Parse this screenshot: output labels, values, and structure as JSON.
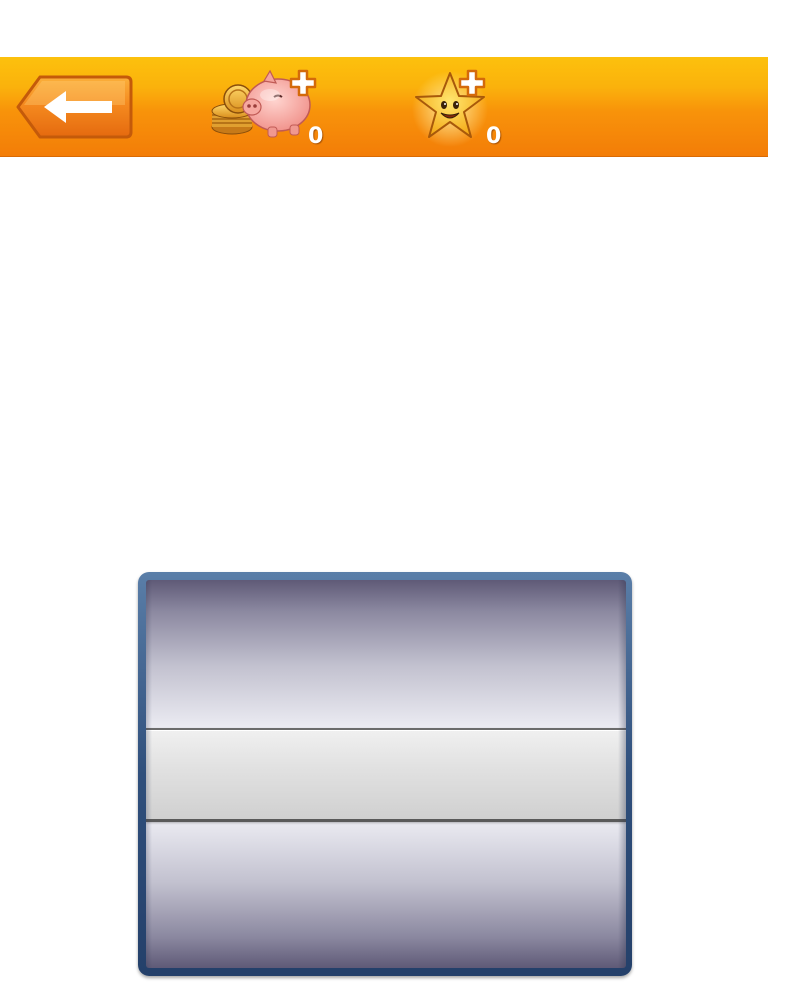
{
  "topbar": {
    "back_icon": "left-arrow-icon",
    "coins": {
      "icon": "piggy-bank-icon",
      "value": "0"
    },
    "stars": {
      "icon": "smiling-star-icon",
      "value": "0"
    },
    "colors": {
      "bar_top": "#fcc10d",
      "bar_bottom": "#f37d08"
    }
  },
  "picker": {
    "frame_color": "#2f4f7c",
    "selected_value": ""
  }
}
